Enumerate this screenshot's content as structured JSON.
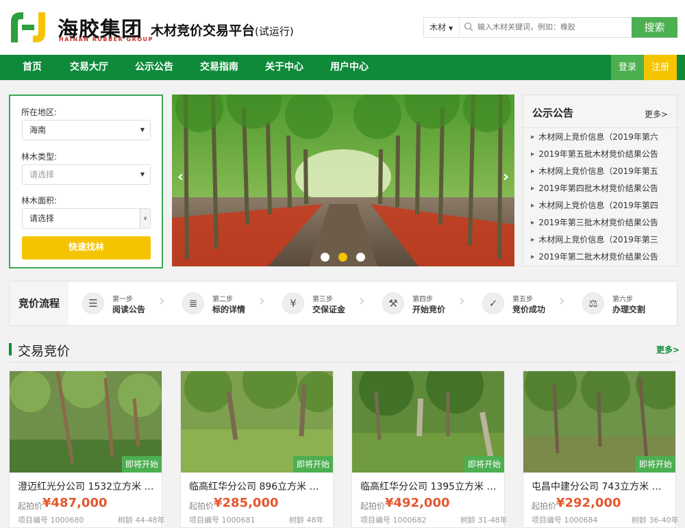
{
  "header": {
    "brand_cn": "海胶集团",
    "brand_en": "HAINAN RUBBER GROUP",
    "platform": "木材竞价交易平台",
    "platform_note": "(试运行)",
    "search": {
      "category": "木材",
      "placeholder": "输入木材关键词，例如：橡胶",
      "button": "搜索"
    }
  },
  "nav": {
    "items": [
      "首页",
      "交易大厅",
      "公示公告",
      "交易指南",
      "关于中心",
      "用户中心"
    ],
    "login": "登录",
    "register": "注册"
  },
  "filter": {
    "region_label": "所在地区:",
    "region_value": "海南",
    "type_label": "林木类型:",
    "type_value": "请选择",
    "area_label": "林木面积:",
    "area_value": "请选择",
    "button": "快速找林"
  },
  "banner": {
    "slide_count": 3,
    "active_slide": 2
  },
  "notices": {
    "title": "公示公告",
    "more": "更多>",
    "items": [
      "木材网上竞价信息（2019年第六",
      "2019年第五批木材竞价结果公告",
      "木材网上竞价信息（2019年第五",
      "2019年第四批木材竞价结果公告",
      "木材网上竞价信息（2019年第四",
      "2019年第三批木材竞价结果公告",
      "木材网上竞价信息（2019年第三",
      "2019年第二批木材竞价结果公告"
    ]
  },
  "process": {
    "title": "竞价流程",
    "steps": [
      {
        "step": "第一步",
        "name": "阅读公告",
        "icon": "document-icon"
      },
      {
        "step": "第二步",
        "name": "标的详情",
        "icon": "list-icon"
      },
      {
        "step": "第三步",
        "name": "交保证金",
        "icon": "money-bag-icon"
      },
      {
        "step": "第四步",
        "name": "开始竞价",
        "icon": "gavel-icon"
      },
      {
        "step": "第五步",
        "name": "竞价成功",
        "icon": "check-icon"
      },
      {
        "step": "第六步",
        "name": "办理交割",
        "icon": "scales-icon"
      }
    ]
  },
  "trading": {
    "title": "交易竞价",
    "more": "更多>",
    "cards": [
      {
        "name": "澄迈红光分公司 1532立方米 橡...",
        "price_label": "起拍价",
        "price": "¥487,000",
        "meta": "项目编号 1000680",
        "age": "树龄 44-48年",
        "badge": "即将开始"
      },
      {
        "name": "临高红华分公司 896立方米 橡...",
        "price_label": "起拍价",
        "price": "¥285,000",
        "meta": "项目编号 1000681",
        "age": "树龄 48年",
        "badge": "即将开始"
      },
      {
        "name": "临高红华分公司 1395立方米 橡...",
        "price_label": "起拍价",
        "price": "¥492,000",
        "meta": "项目编号 1000682",
        "age": "树龄 31-48年",
        "badge": "即将开始"
      },
      {
        "name": "屯昌中建分公司 743立方米 橡...",
        "price_label": "起拍价",
        "price": "¥292,000",
        "meta": "项目编号 1000684",
        "age": "树龄 36-40年",
        "badge": "即将开始"
      }
    ]
  },
  "colors": {
    "brand_green": "#0e8a3a",
    "accent_yellow": "#f5c400",
    "button_green": "#4caf50",
    "price_red": "#e4572e"
  }
}
